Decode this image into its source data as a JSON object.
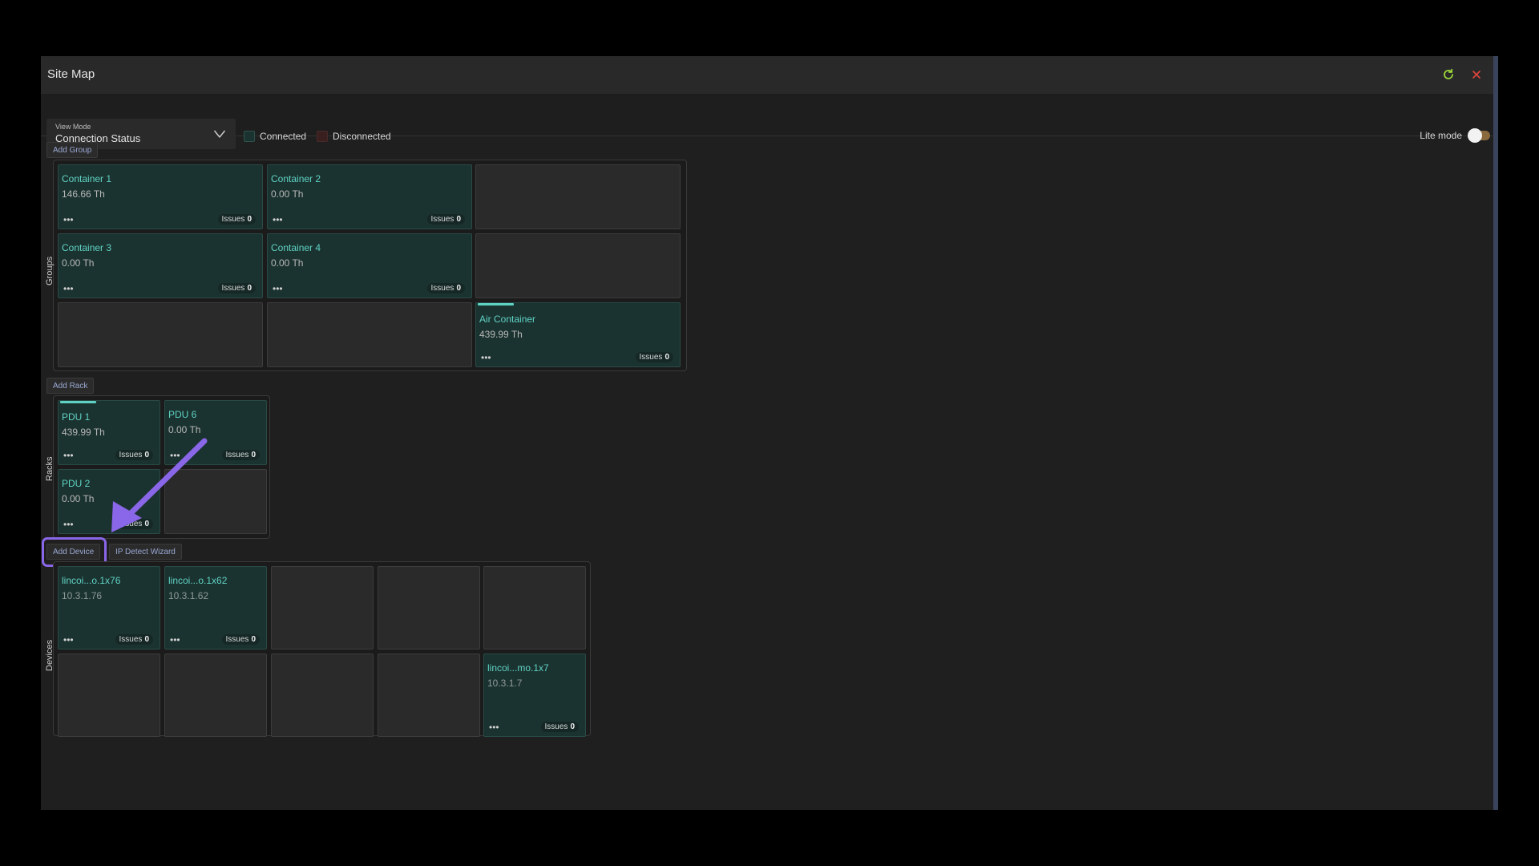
{
  "window": {
    "title": "Site Map"
  },
  "toolbar": {
    "view_mode_label": "View Mode",
    "view_mode_value": "Connection Status",
    "legend_connected": "Connected",
    "legend_disconnected": "Disconnected",
    "lite_mode_label": "Lite mode",
    "lite_mode_on": false
  },
  "colors": {
    "accent_teal": "#5fd2c4",
    "card_bg": "#1b3330",
    "empty_card_bg": "#2a2a2a",
    "highlight_purple": "#8a66e8",
    "refresh_green": "#9ad43a",
    "close_red": "#e0463c"
  },
  "groups": {
    "label": "Groups",
    "add_button": "Add Group",
    "cards": [
      {
        "name": "Container 1",
        "value": "146.66 Th",
        "issues_label": "Issues",
        "issues": "0"
      },
      {
        "name": "Container 2",
        "value": "0.00 Th",
        "issues_label": "Issues",
        "issues": "0"
      },
      {
        "name": "Container 3",
        "value": "0.00 Th",
        "issues_label": "Issues",
        "issues": "0"
      },
      {
        "name": "Container 4",
        "value": "0.00 Th",
        "issues_label": "Issues",
        "issues": "0"
      },
      {
        "name": "Air Container",
        "value": "439.99 Th",
        "issues_label": "Issues",
        "issues": "0"
      }
    ]
  },
  "racks": {
    "label": "Racks",
    "add_button": "Add Rack",
    "cards": [
      {
        "name": "PDU 1",
        "value": "439.99 Th",
        "issues_label": "Issues",
        "issues": "0"
      },
      {
        "name": "PDU 6",
        "value": "0.00 Th",
        "issues_label": "Issues",
        "issues": "0"
      },
      {
        "name": "PDU 2",
        "value": "0.00 Th",
        "issues_label": "Issues",
        "issues": "0"
      }
    ]
  },
  "devices": {
    "label": "Devices",
    "add_button": "Add Device",
    "wizard_button": "IP Detect Wizard",
    "cards": [
      {
        "name": "lincoi...o.1x76",
        "value": "10.3.1.76",
        "issues_label": "Issues",
        "issues": "0"
      },
      {
        "name": "lincoi...o.1x62",
        "value": "10.3.1.62",
        "issues_label": "Issues",
        "issues": "0"
      },
      {
        "name": "lincoi...mo.1x7",
        "value": "10.3.1.7",
        "issues_label": "Issues",
        "issues": "0"
      }
    ]
  }
}
